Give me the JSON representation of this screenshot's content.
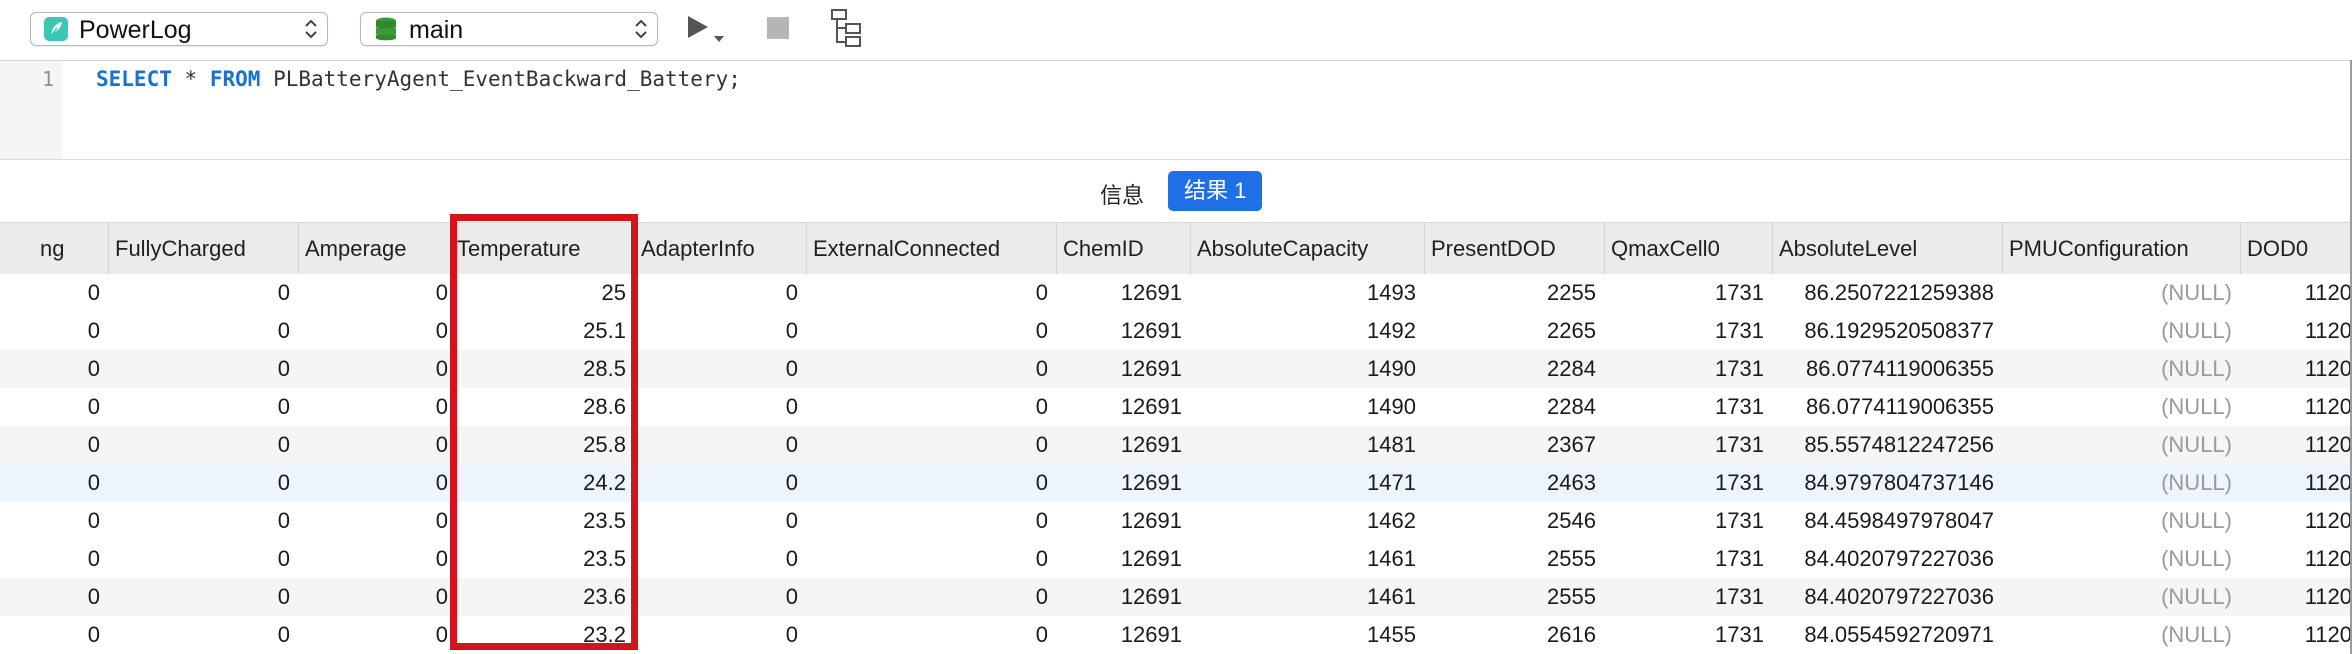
{
  "toolbar": {
    "database_label": "PowerLog",
    "schema_label": "main"
  },
  "editor": {
    "line_number": "1",
    "sql_keyword_select": "SELECT",
    "sql_star": "*",
    "sql_keyword_from": "FROM",
    "sql_table": "PLBatteryAgent_EventBackward_Battery;"
  },
  "result_tabs": {
    "info_label": "信息",
    "result_label": "结果 1"
  },
  "grid": {
    "columns": [
      "ng",
      "FullyCharged",
      "Amperage",
      "Temperature",
      "AdapterInfo",
      "ExternalConnected",
      "ChemID",
      "AbsoluteCapacity",
      "PresentDOD",
      "QmaxCell0",
      "AbsoluteLevel",
      "PMUConfiguration",
      "DOD0"
    ],
    "rows": [
      [
        "0",
        "0",
        "0",
        "25",
        "0",
        "0",
        "12691",
        "1493",
        "2255",
        "1731",
        "86.2507221259388",
        "(NULL)",
        "1120"
      ],
      [
        "0",
        "0",
        "0",
        "25.1",
        "0",
        "0",
        "12691",
        "1492",
        "2265",
        "1731",
        "86.1929520508377",
        "(NULL)",
        "1120"
      ],
      [
        "0",
        "0",
        "0",
        "28.5",
        "0",
        "0",
        "12691",
        "1490",
        "2284",
        "1731",
        "86.0774119006355",
        "(NULL)",
        "1120"
      ],
      [
        "0",
        "0",
        "0",
        "28.6",
        "0",
        "0",
        "12691",
        "1490",
        "2284",
        "1731",
        "86.0774119006355",
        "(NULL)",
        "1120"
      ],
      [
        "0",
        "0",
        "0",
        "25.8",
        "0",
        "0",
        "12691",
        "1481",
        "2367",
        "1731",
        "85.5574812247256",
        "(NULL)",
        "1120"
      ],
      [
        "0",
        "0",
        "0",
        "24.2",
        "0",
        "0",
        "12691",
        "1471",
        "2463",
        "1731",
        "84.9797804737146",
        "(NULL)",
        "1120"
      ],
      [
        "0",
        "0",
        "0",
        "23.5",
        "0",
        "0",
        "12691",
        "1462",
        "2546",
        "1731",
        "84.4598497978047",
        "(NULL)",
        "1120"
      ],
      [
        "0",
        "0",
        "0",
        "23.5",
        "0",
        "0",
        "12691",
        "1461",
        "2555",
        "1731",
        "84.4020797227036",
        "(NULL)",
        "1120"
      ],
      [
        "0",
        "0",
        "0",
        "23.6",
        "0",
        "0",
        "12691",
        "1461",
        "2555",
        "1731",
        "84.4020797227036",
        "(NULL)",
        "1120"
      ],
      [
        "0",
        "0",
        "0",
        "23.2",
        "0",
        "0",
        "12691",
        "1455",
        "2616",
        "1731",
        "84.0554592720971",
        "(NULL)",
        "1120"
      ]
    ]
  },
  "colors": {
    "accent": "#1f6fe8",
    "highlight": "#d2141c",
    "row_alt": "#f5f5f5",
    "row_selected": "#eef4fb"
  }
}
